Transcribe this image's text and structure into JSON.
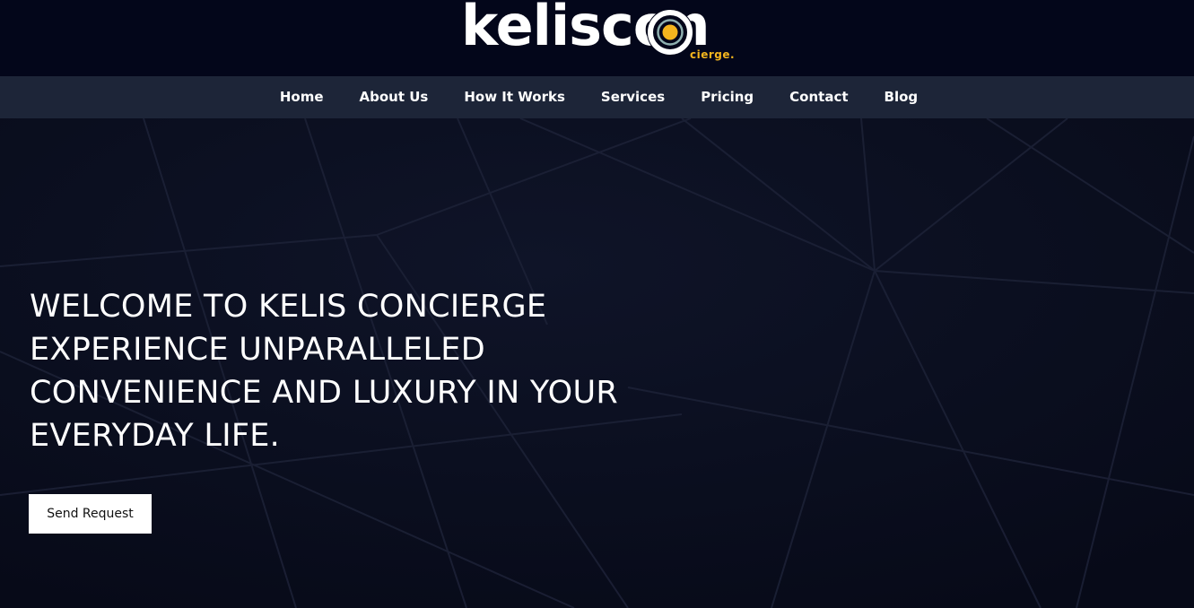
{
  "header": {
    "logo": {
      "wordmark": "keliscon",
      "tagline": "cierge.",
      "accent_color": "#f4b51e"
    }
  },
  "nav": {
    "items": [
      {
        "label": "Home"
      },
      {
        "label": "About Us"
      },
      {
        "label": "How It Works"
      },
      {
        "label": "Services"
      },
      {
        "label": "Pricing"
      },
      {
        "label": "Contact"
      },
      {
        "label": "Blog"
      }
    ]
  },
  "hero": {
    "title_lines": [
      "WELCOME TO KELIS CONCIERGE",
      "EXPERIENCE UNPARALLELED",
      "CONVENIENCE AND LUXURY IN YOUR",
      "EVERYDAY LIFE."
    ],
    "cta_label": "Send Request"
  },
  "colors": {
    "header_bg": "#03061a",
    "nav_bg": "#1d2538",
    "hero_bg": "#0b0f21",
    "text": "#ffffff",
    "button_bg": "#ffffff"
  }
}
